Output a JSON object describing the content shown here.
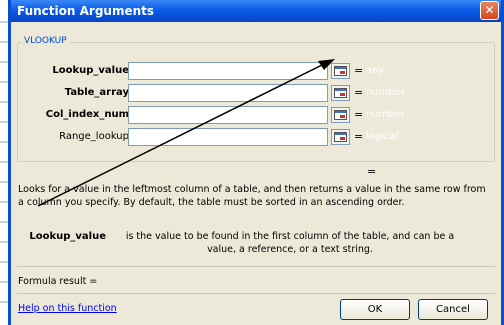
{
  "dialog": {
    "title": "Function Arguments",
    "close_glyph": "✕",
    "function_name": "VLOOKUP",
    "arguments": [
      {
        "label": "Lookup_value",
        "bold": true,
        "type_hint": "any",
        "value": ""
      },
      {
        "label": "Table_array",
        "bold": true,
        "type_hint": "number",
        "value": ""
      },
      {
        "label": "Col_index_num",
        "bold": true,
        "type_hint": "number",
        "value": ""
      },
      {
        "label": "Range_lookup",
        "bold": false,
        "type_hint": "logical",
        "value": ""
      }
    ],
    "equals": "=",
    "result_equals": "=",
    "description": "Looks for a value in the leftmost column of a table, and then returns a value in the same row from a column you specify. By default, the table must be sorted in an ascending order.",
    "arg_help": {
      "name": "Lookup_value",
      "text": "is the value to be found in the first column of the table, and can be a value, a reference, or a text string."
    },
    "formula_result": "Formula result =",
    "help_link": "Help on this function",
    "ok_label": "OK",
    "cancel_label": "Cancel"
  },
  "colors": {
    "titlebar": "#0a5be8",
    "group_label": "#0046d5",
    "link": "#0000ff",
    "type_hint": "#ffffff"
  },
  "icons": {
    "close": "close-icon",
    "collapse": "collapse-dialog-icon",
    "annotation": "annotation-arrow"
  }
}
